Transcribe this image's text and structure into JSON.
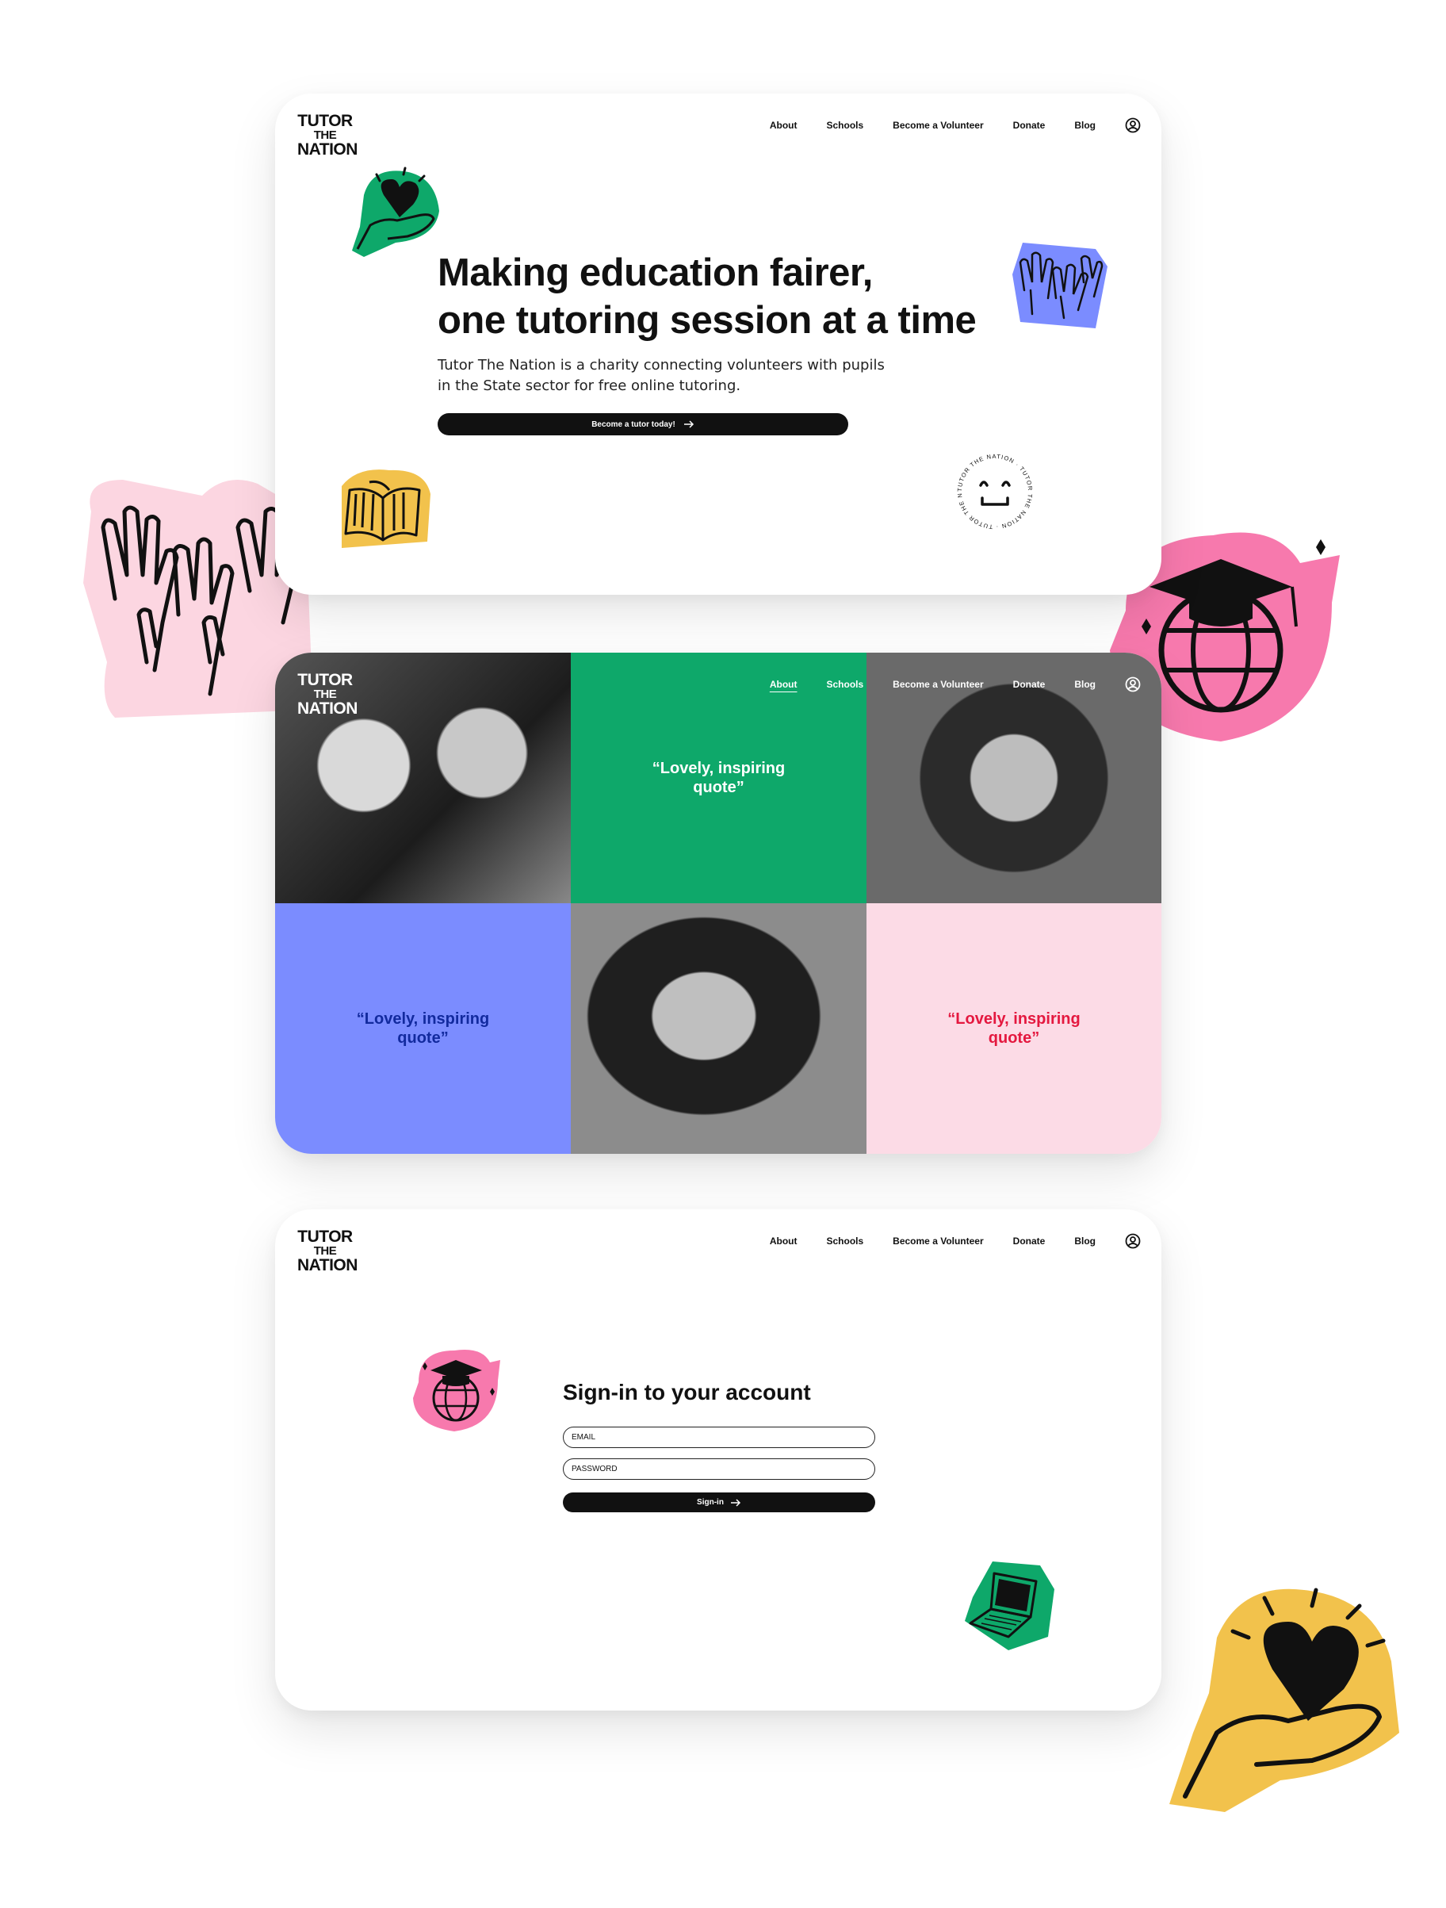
{
  "brand": {
    "logo_line1": "TUTOR",
    "logo_line2": "THE",
    "logo_line3": "NATION"
  },
  "nav": {
    "items": [
      "About",
      "Schools",
      "Become a Volunteer",
      "Donate",
      "Blog"
    ],
    "active_on_gallery": "About",
    "account_icon": "user-circle-icon"
  },
  "hero": {
    "title_line1": "Making education fairer,",
    "title_line2": "one tutoring session at a time",
    "description_line1": "Tutor The Nation is a charity connecting volunteers with pupils",
    "description_line2": "in the State sector for free online tutoring.",
    "cta_label": "Become a tutor today!",
    "stamp_text": "TUTOR THE NATION · TUTOR THE NATION · TUTOR THE NATION ·"
  },
  "gallery": {
    "quotes": [
      {
        "text": "“Lovely, inspiring quote”",
        "bg": "#0ea86a",
        "color": "#ffffff"
      },
      {
        "text": "“Lovely, inspiring quote”",
        "bg": "#7b8cff",
        "color": "#122a9e"
      },
      {
        "text": "“Lovely, inspiring quote”",
        "bg": "#fcdbe6",
        "color": "#e4183f"
      }
    ]
  },
  "signin": {
    "title": "Sign-in to your account",
    "email_placeholder": "EMAIL",
    "password_placeholder": "PASSWORD",
    "button_label": "Sign-in"
  },
  "colors": {
    "green": "#0ea86a",
    "blue": "#7b8cff",
    "pink": "#fcdbe6",
    "hot_pink": "#f779ad",
    "yellow": "#f2c24c",
    "light_pink": "#fcd6e1"
  }
}
